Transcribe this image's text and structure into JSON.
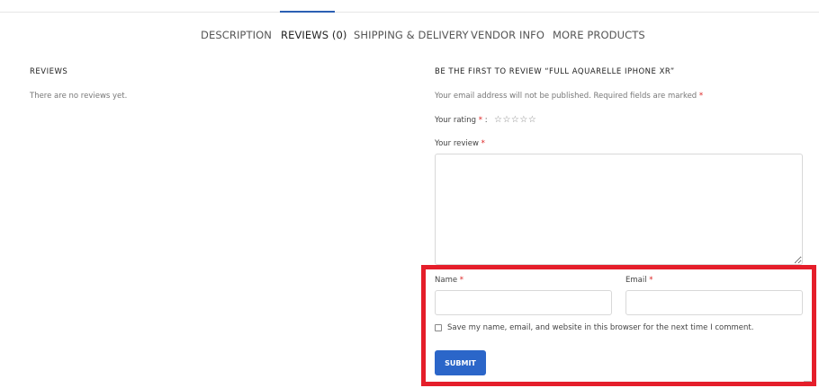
{
  "tabs": [
    {
      "label": "DESCRIPTION",
      "active": false
    },
    {
      "label": "REVIEWS (0)",
      "active": true
    },
    {
      "label": "SHIPPING & DELIVERY",
      "active": false
    },
    {
      "label": "VENDOR INFO",
      "active": false
    },
    {
      "label": "MORE PRODUCTS",
      "active": false
    }
  ],
  "reviews": {
    "heading": "REVIEWS",
    "empty_text": "There are no reviews yet."
  },
  "form": {
    "heading": "BE THE FIRST TO REVIEW “FULL AQUARELLE IPHONE XR”",
    "notice": "Your email address will not be published. Required fields are marked",
    "required_mark": "*",
    "rating_label": "Your rating",
    "rating_suffix": ":",
    "rating_stars": "☆☆☆☆☆",
    "review_label": "Your review",
    "review_value": "",
    "name_label": "Name",
    "name_value": "",
    "email_label": "Email",
    "email_value": "",
    "save_info_label": "Save my name, email, and website in this browser for the next time I comment.",
    "submit_label": "SUBMIT"
  },
  "colors": {
    "accent": "#2b66c9",
    "tab_active_border": "#2b5fb3",
    "required": "#dd2222",
    "highlight": "#e51e2a"
  }
}
